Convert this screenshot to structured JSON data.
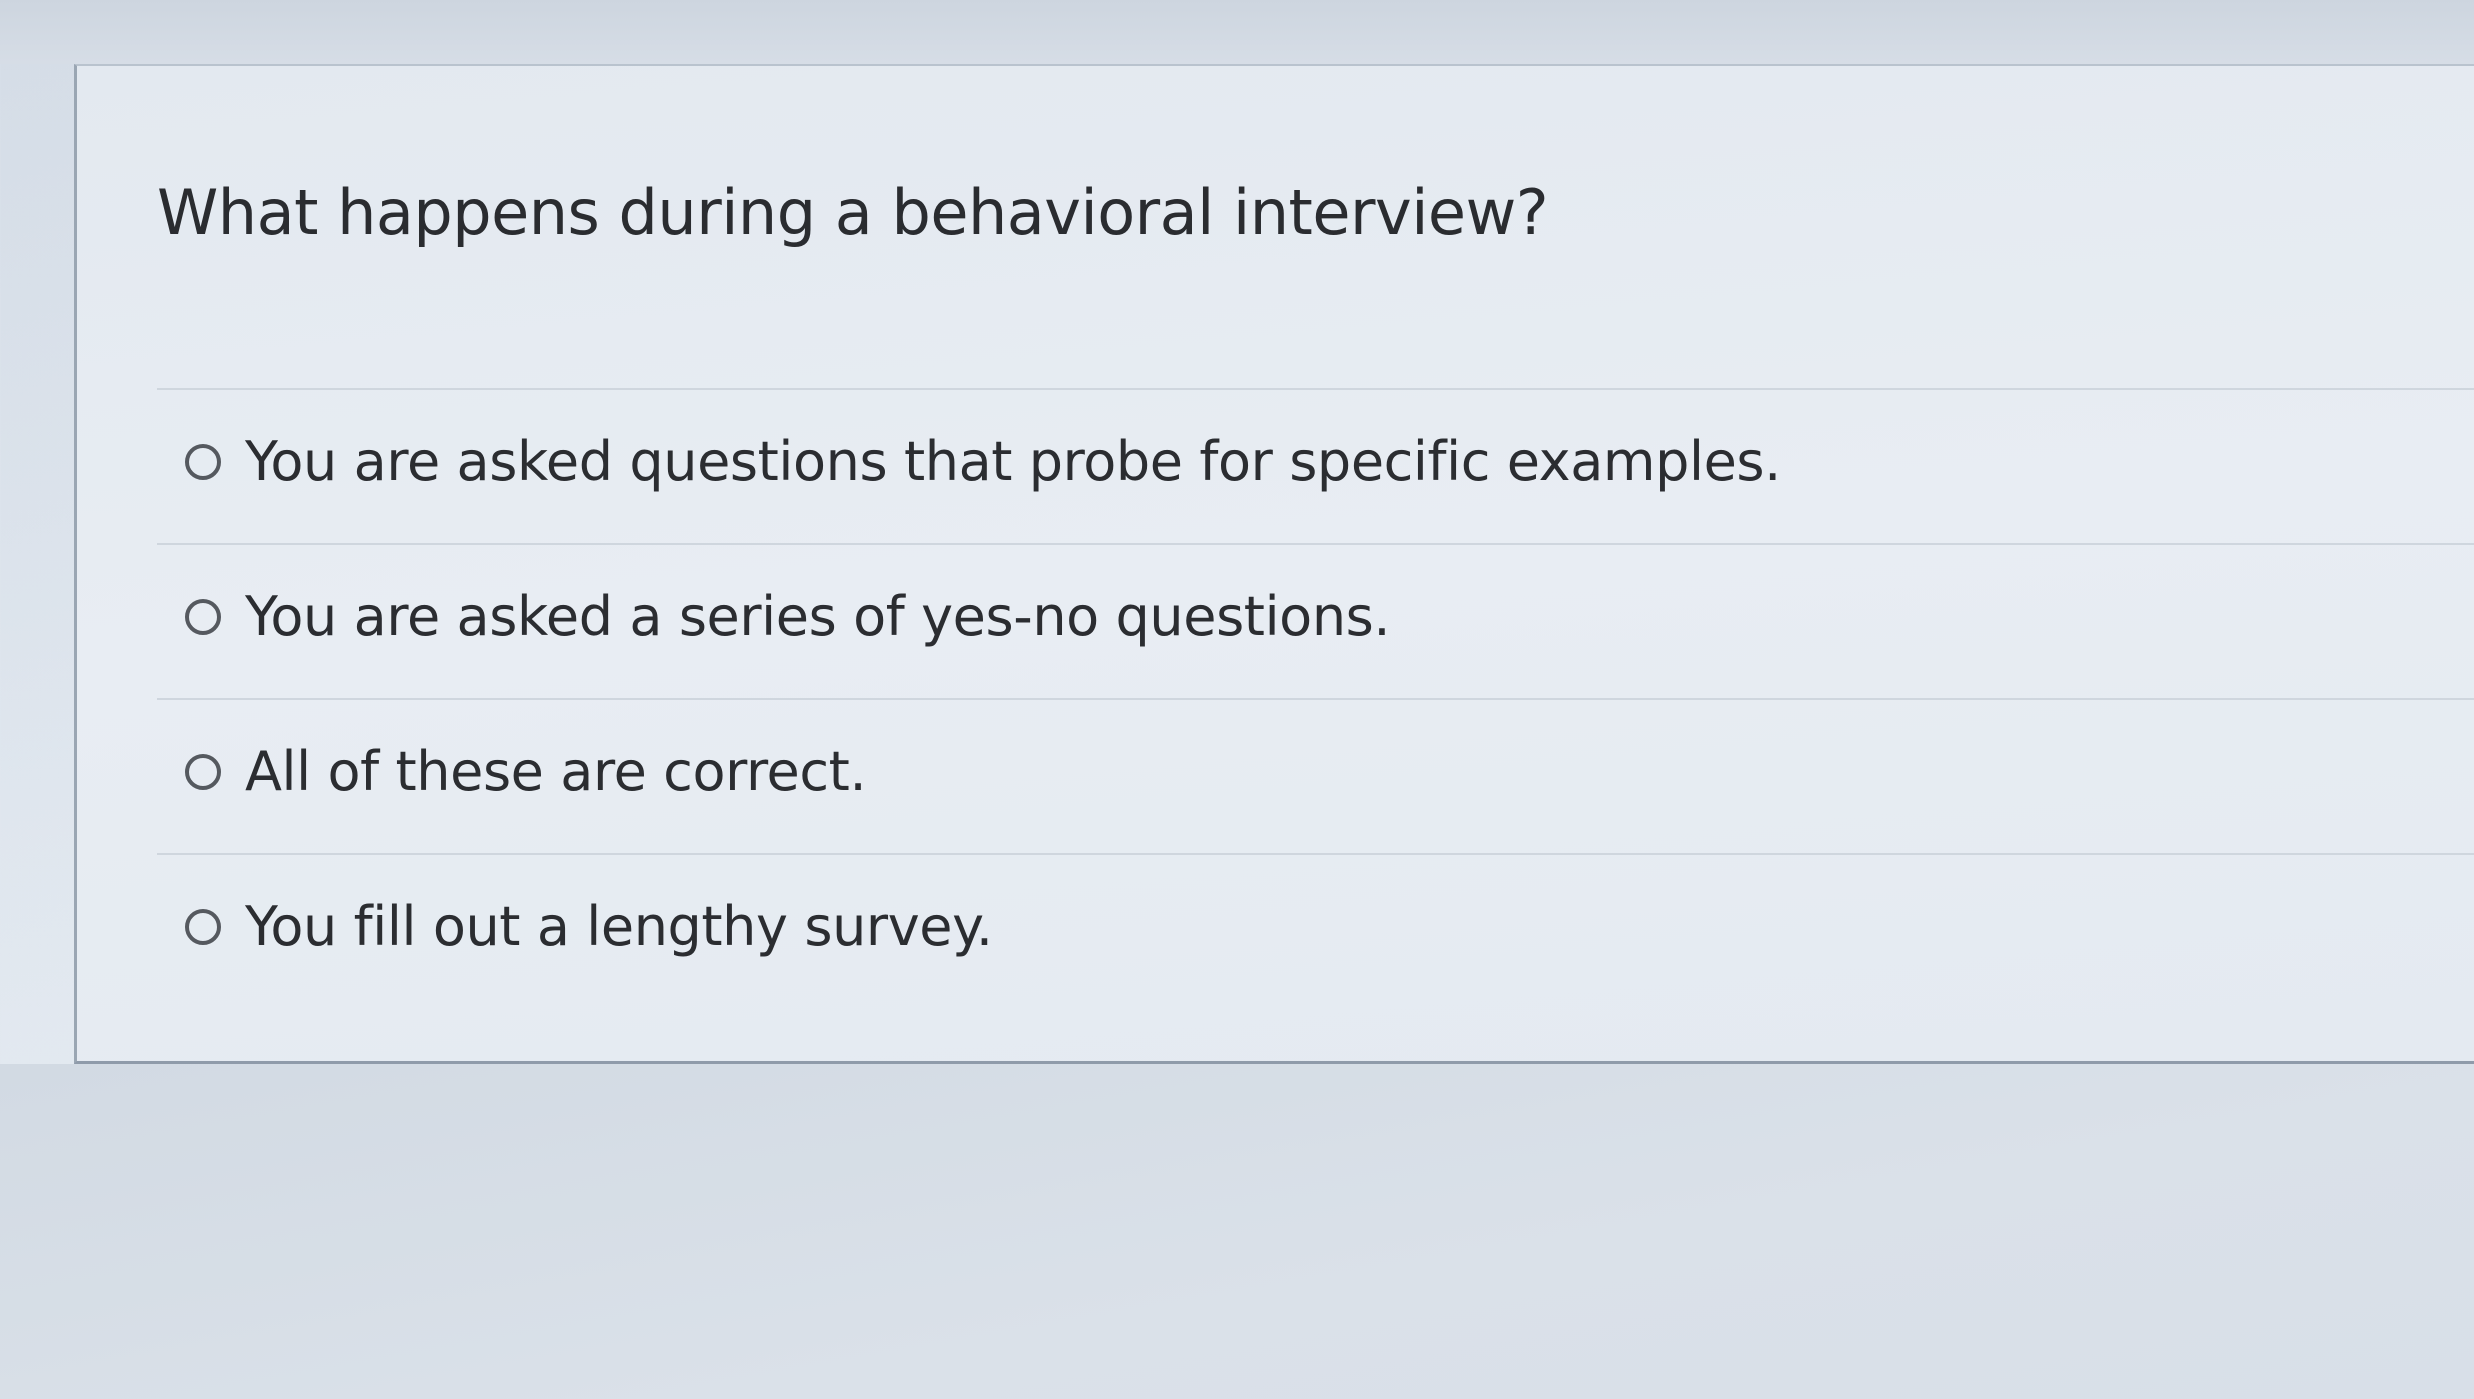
{
  "question": {
    "text": "What happens during a behavioral interview?"
  },
  "answers": [
    {
      "label": "You are asked questions that probe for specific examples.",
      "selected": false
    },
    {
      "label": "You are asked a series of yes-no questions.",
      "selected": false
    },
    {
      "label": "All of these are correct.",
      "selected": false
    },
    {
      "label": "You fill out a lengthy survey.",
      "selected": false
    }
  ],
  "icons": {
    "radio": "radio-unselected-icon"
  }
}
